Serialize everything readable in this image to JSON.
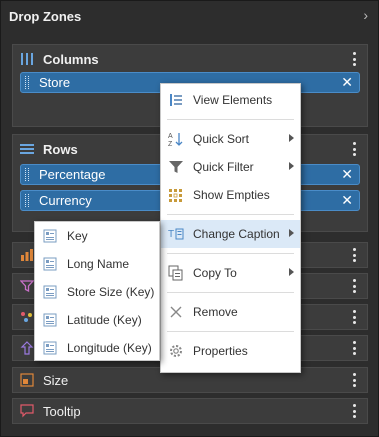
{
  "panel": {
    "title": "Drop Zones"
  },
  "zones": {
    "columns": {
      "label": "Columns",
      "chips": [
        {
          "label": "Store"
        }
      ]
    },
    "rows": {
      "label": "Rows",
      "chips": [
        {
          "label": "Percentage"
        },
        {
          "label": "Currency"
        }
      ]
    },
    "size": {
      "label": "Size"
    },
    "tooltip": {
      "label": "Tooltip"
    }
  },
  "context_menu": {
    "items": [
      {
        "label": "View Elements",
        "icon": "view-elements-icon"
      },
      {
        "label": "Quick Sort",
        "icon": "sort-az-icon",
        "submenu": true
      },
      {
        "label": "Quick Filter",
        "icon": "filter-icon",
        "submenu": true
      },
      {
        "label": "Show Empties",
        "icon": "grid-empties-icon"
      },
      {
        "label": "Change Caption",
        "icon": "caption-icon",
        "submenu": true,
        "active": true
      },
      {
        "label": "Copy To",
        "icon": "copy-icon",
        "submenu": true
      },
      {
        "label": "Remove",
        "icon": "remove-icon"
      },
      {
        "label": "Properties",
        "icon": "gear-icon"
      }
    ]
  },
  "caption_submenu": {
    "items": [
      {
        "label": "Key"
      },
      {
        "label": "Long Name"
      },
      {
        "label": "Store Size (Key)"
      },
      {
        "label": "Latitude (Key)"
      },
      {
        "label": "Longitude (Key)"
      }
    ]
  },
  "colors": {
    "chip": "#2e6da4",
    "accent_columns": "#6aa6e0",
    "accent_filter": "#c971c9",
    "accent_size": "#e0873a",
    "accent_tooltip": "#e05a6a"
  }
}
